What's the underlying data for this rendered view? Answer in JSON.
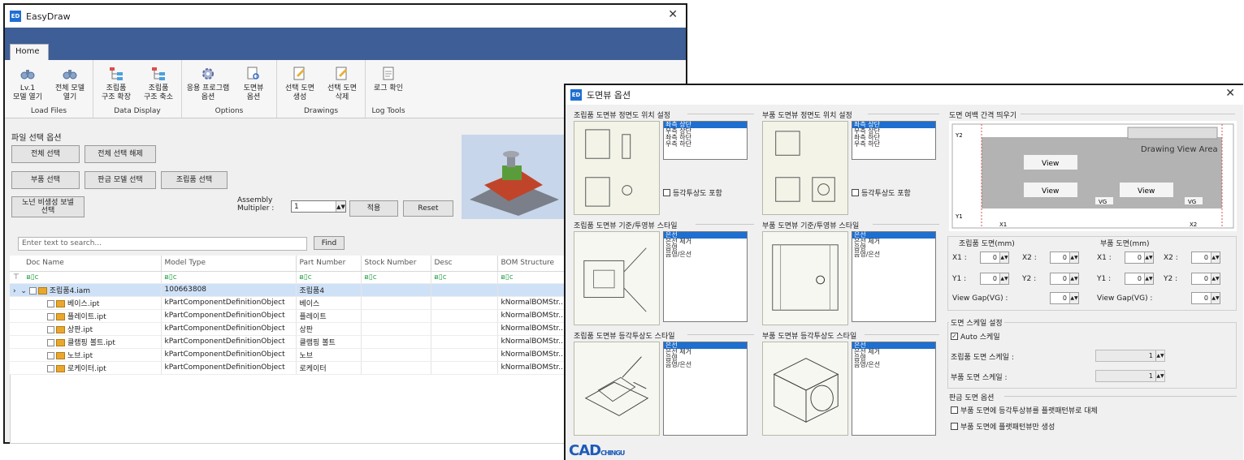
{
  "main_window": {
    "title": "EasyDraw",
    "tab": "Home",
    "ribbon": {
      "groups": [
        {
          "label": "Load Files",
          "buttons": [
            "Lv.1\n모델 열기",
            "전체 모델\n열기"
          ]
        },
        {
          "label": "Data Display",
          "buttons": [
            "조립품\n구조 확장",
            "조립품\n구조 축소"
          ]
        },
        {
          "label": "Options",
          "buttons": [
            "응용 프로그램\n옵션",
            "도면뷰\n옵션"
          ]
        },
        {
          "label": "Drawings",
          "buttons": [
            "선택 도면\n생성",
            "선택 도면\n삭제"
          ]
        },
        {
          "label": "Log Tools",
          "buttons": [
            "로그 확인"
          ]
        }
      ]
    },
    "file_select": {
      "title": "파일 선택 옵션",
      "select_all": "전체 선택",
      "deselect_all": "전체 선택 해제",
      "part_select": "부품 선택",
      "sheet_model_select": "판금 모델 선택",
      "assembly_select": "조립품 선택",
      "sno_select": "노넌 비생성 보넬\n선택",
      "assembly_multiplier_label": "Assembly\nMultipler :",
      "assembly_multiplier_value": "1",
      "apply": "적용",
      "reset": "Reset"
    },
    "search": {
      "placeholder": "Enter text to search...",
      "find": "Find"
    },
    "grid": {
      "columns": [
        "Doc Name",
        "Model Type",
        "Part Number",
        "Stock Number",
        "Desc",
        "BOM Structure"
      ],
      "filter_glyph": "ᴃ▯c",
      "rows": [
        {
          "name": "조립품4.iam",
          "type": "100663808",
          "part": "조립품4",
          "stock": "",
          "desc": "",
          "bom": "",
          "level": 0
        },
        {
          "name": "베이스.ipt",
          "type": "kPartComponentDefinitionObject",
          "part": "베이스",
          "stock": "",
          "desc": "",
          "bom": "kNormalBOMStr...",
          "level": 1
        },
        {
          "name": "플레이트.ipt",
          "type": "kPartComponentDefinitionObject",
          "part": "플레이트",
          "stock": "",
          "desc": "",
          "bom": "kNormalBOMStr...",
          "level": 1
        },
        {
          "name": "상판.ipt",
          "type": "kPartComponentDefinitionObject",
          "part": "상판",
          "stock": "",
          "desc": "",
          "bom": "kNormalBOMStr...",
          "level": 1
        },
        {
          "name": "클램핑 볼트.ipt",
          "type": "kPartComponentDefinitionObject",
          "part": "클램핑 볼트",
          "stock": "",
          "desc": "",
          "bom": "kNormalBOMStr...",
          "level": 1
        },
        {
          "name": "노브.ipt",
          "type": "kPartComponentDefinitionObject",
          "part": "노브",
          "stock": "",
          "desc": "",
          "bom": "kNormalBOMStr...",
          "level": 1
        },
        {
          "name": "로케이터.ipt",
          "type": "kPartComponentDefinitionObject",
          "part": "로케이터",
          "stock": "",
          "desc": "",
          "bom": "kNormalBOMStr...",
          "level": 1
        }
      ]
    }
  },
  "dialog": {
    "title": "도면뷰 옵션",
    "asm_front_title": "조립품 도면뷰 정면도 위치 설정",
    "part_front_title": "부품 도면뷰 정면도 위치 설정",
    "position_options": [
      "좌측 상단",
      "우측 상단",
      "좌측 하단",
      "우측 하단"
    ],
    "iso_include": "등각투상도 포함",
    "asm_base_style_title": "조립품 도면뷰 기준/투영뷰 스타일",
    "part_base_style_title": "부품 도면뷰 기준/투영뷰 스타일",
    "asm_iso_style_title": "조립품 도면뷰 등각투상도 스타일",
    "part_iso_style_title": "부품 도면뷰 등각투상도 스타일",
    "style_options": [
      "은선",
      "은선 제거",
      "음영",
      "음영/은선"
    ],
    "margin_title": "도면 여백 간격 띄우기",
    "preview": {
      "area": "Drawing View Area",
      "view": "View",
      "vg": "VG",
      "y1": "Y1",
      "y2": "Y2",
      "x1": "X1",
      "x2": "X2"
    },
    "asm_drawing": {
      "title": "조립품 도면(mm)",
      "x1": "X1 :",
      "x2": "X2 :",
      "y1": "Y1 :",
      "y2": "Y2 :",
      "gap": "View Gap(VG) :",
      "value": "0"
    },
    "part_drawing": {
      "title": "부품 도면(mm)",
      "x1": "X1 :",
      "x2": "X2 :",
      "y1": "Y1 :",
      "y2": "Y2 :",
      "gap": "View Gap(VG) :",
      "value": "0"
    },
    "scale": {
      "title": "도면 스케일 설정",
      "auto": "Auto 스케일",
      "asm_label": "조립품 도면 스케일 :",
      "part_label": "부품 도면 스케일 :",
      "value": "1"
    },
    "sheet": {
      "title": "판금 도면 옵션",
      "opt1": "부품 도면에 등각투상뷰를 플랫패턴뷰로 대체",
      "opt2": "부품 도면에 플랫패턴뷰만 생성"
    },
    "logo": "CAD",
    "logo_sub": "CHINGU"
  }
}
